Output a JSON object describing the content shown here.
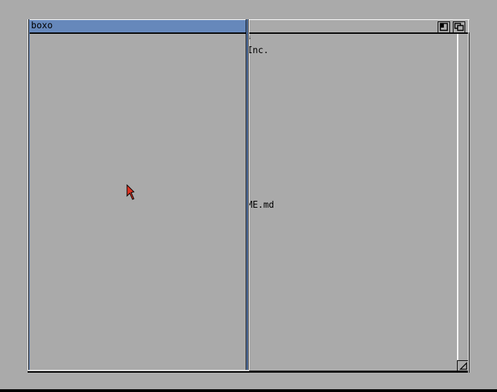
{
  "screen": {
    "background_color": "#aaaaaa",
    "accent_color": "#6688bb"
  },
  "front_window": {
    "title": "boxo"
  },
  "back_window": {
    "visible_lines": [
      {
        "text": "s"
      },
      {
        "text": "Inc."
      },
      {
        "text": "ME.md"
      }
    ]
  },
  "icons": {
    "zoom_gadget": "zoom-icon",
    "depth_gadget": "depth-icon",
    "size_gadget": "resize-icon",
    "pointer": "mouse-pointer-icon"
  }
}
